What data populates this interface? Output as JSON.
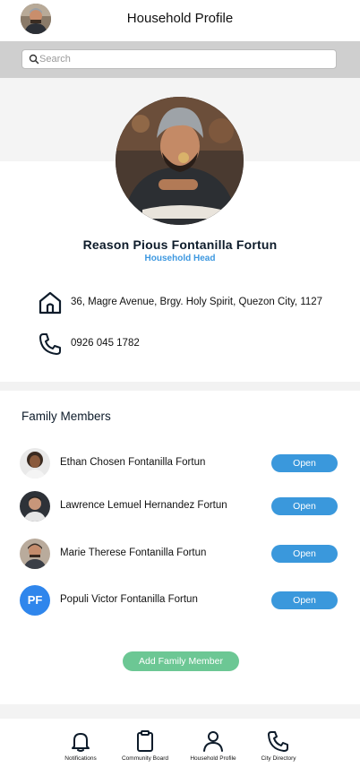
{
  "header": {
    "title": "Household Profile",
    "avatar_icon": "user-avatar"
  },
  "search": {
    "placeholder": "Search",
    "icon": "search-icon"
  },
  "profile": {
    "photo_icon": "profile-photo",
    "name": "Reason Pious Fontanilla Fortun",
    "role": "Household Head",
    "address": "36, Magre Avenue, Brgy. Holy Spirit, Quezon City, 1127",
    "phone": "0926 045 1782",
    "address_icon": "home-icon",
    "phone_icon": "phone-icon"
  },
  "family": {
    "title": "Family Members",
    "members": [
      {
        "name": "Ethan Chosen Fontanilla Fortun",
        "button": "Open",
        "avatar": "photo"
      },
      {
        "name": "Lawrence Lemuel Hernandez Fortun",
        "button": "Open",
        "avatar": "photo"
      },
      {
        "name": "Marie Therese Fontanilla Fortun",
        "button": "Open",
        "avatar": "photo"
      },
      {
        "name": "Populi Victor Fontanilla Fortun",
        "button": "Open",
        "avatar": "initials",
        "initials": "PF"
      }
    ],
    "add_button": "Add Family Member"
  },
  "tabbar": {
    "items": [
      {
        "label": "Notifications",
        "icon": "bell-icon"
      },
      {
        "label": "Community Board",
        "icon": "clipboard-icon"
      },
      {
        "label": "Household Profile",
        "icon": "user-icon"
      },
      {
        "label": "City Directory",
        "icon": "phone-icon"
      }
    ]
  },
  "colors": {
    "accent_blue": "#3a98dc",
    "role_blue": "#3d98e0",
    "add_green": "#6cc794",
    "initials_blue": "#2f86ec"
  }
}
